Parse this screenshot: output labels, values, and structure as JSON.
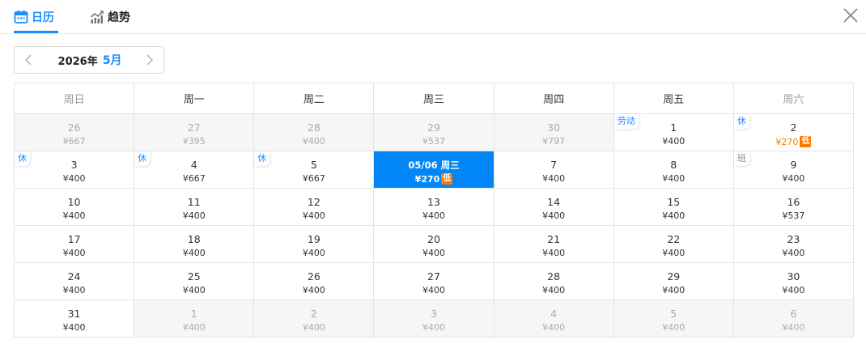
{
  "tabs": [
    {
      "label": "日历",
      "icon": "calendar-icon",
      "active": true
    },
    {
      "label": "趋势",
      "icon": "trend-chart-icon",
      "active": false
    }
  ],
  "colors": {
    "accent": "#1a8cff",
    "selected_bg": "#0086f6",
    "low_price": "#ff7700"
  },
  "month_nav": {
    "year": "2026年",
    "month": "5月"
  },
  "weekdays": [
    "周日",
    "周一",
    "周二",
    "周三",
    "周四",
    "周五",
    "周六"
  ],
  "weeks": [
    [
      {
        "day": "26",
        "price": "¥667",
        "other": true
      },
      {
        "day": "27",
        "price": "¥395",
        "other": true
      },
      {
        "day": "28",
        "price": "¥400",
        "other": true
      },
      {
        "day": "29",
        "price": "¥537",
        "other": true
      },
      {
        "day": "30",
        "price": "¥797",
        "other": true
      },
      {
        "day": "1",
        "price": "¥400",
        "tag": "劳动"
      },
      {
        "day": "2",
        "price": "¥270",
        "tag": "休",
        "low": true,
        "badge": "低"
      }
    ],
    [
      {
        "day": "3",
        "price": "¥400",
        "tag": "休"
      },
      {
        "day": "4",
        "price": "¥667",
        "tag": "休"
      },
      {
        "day": "5",
        "price": "¥667",
        "tag": "休"
      },
      {
        "day": "05/06 周三",
        "price": "¥270",
        "selected": true,
        "badge": "低"
      },
      {
        "day": "7",
        "price": "¥400"
      },
      {
        "day": "8",
        "price": "¥400"
      },
      {
        "day": "9",
        "price": "¥400",
        "tag": "班",
        "tag_type": "ban"
      }
    ],
    [
      {
        "day": "10",
        "price": "¥400"
      },
      {
        "day": "11",
        "price": "¥400"
      },
      {
        "day": "12",
        "price": "¥400"
      },
      {
        "day": "13",
        "price": "¥400"
      },
      {
        "day": "14",
        "price": "¥400"
      },
      {
        "day": "15",
        "price": "¥400"
      },
      {
        "day": "16",
        "price": "¥537"
      }
    ],
    [
      {
        "day": "17",
        "price": "¥400"
      },
      {
        "day": "18",
        "price": "¥400"
      },
      {
        "day": "19",
        "price": "¥400"
      },
      {
        "day": "20",
        "price": "¥400"
      },
      {
        "day": "21",
        "price": "¥400"
      },
      {
        "day": "22",
        "price": "¥400"
      },
      {
        "day": "23",
        "price": "¥400"
      }
    ],
    [
      {
        "day": "24",
        "price": "¥400"
      },
      {
        "day": "25",
        "price": "¥400"
      },
      {
        "day": "26",
        "price": "¥400"
      },
      {
        "day": "27",
        "price": "¥400"
      },
      {
        "day": "28",
        "price": "¥400"
      },
      {
        "day": "29",
        "price": "¥400"
      },
      {
        "day": "30",
        "price": "¥400"
      }
    ],
    [
      {
        "day": "31",
        "price": "¥400"
      },
      {
        "day": "1",
        "price": "¥400",
        "other": true
      },
      {
        "day": "2",
        "price": "¥400",
        "other": true
      },
      {
        "day": "3",
        "price": "¥400",
        "other": true
      },
      {
        "day": "4",
        "price": "¥400",
        "other": true
      },
      {
        "day": "5",
        "price": "¥400",
        "other": true
      },
      {
        "day": "6",
        "price": "¥400",
        "other": true
      }
    ]
  ]
}
